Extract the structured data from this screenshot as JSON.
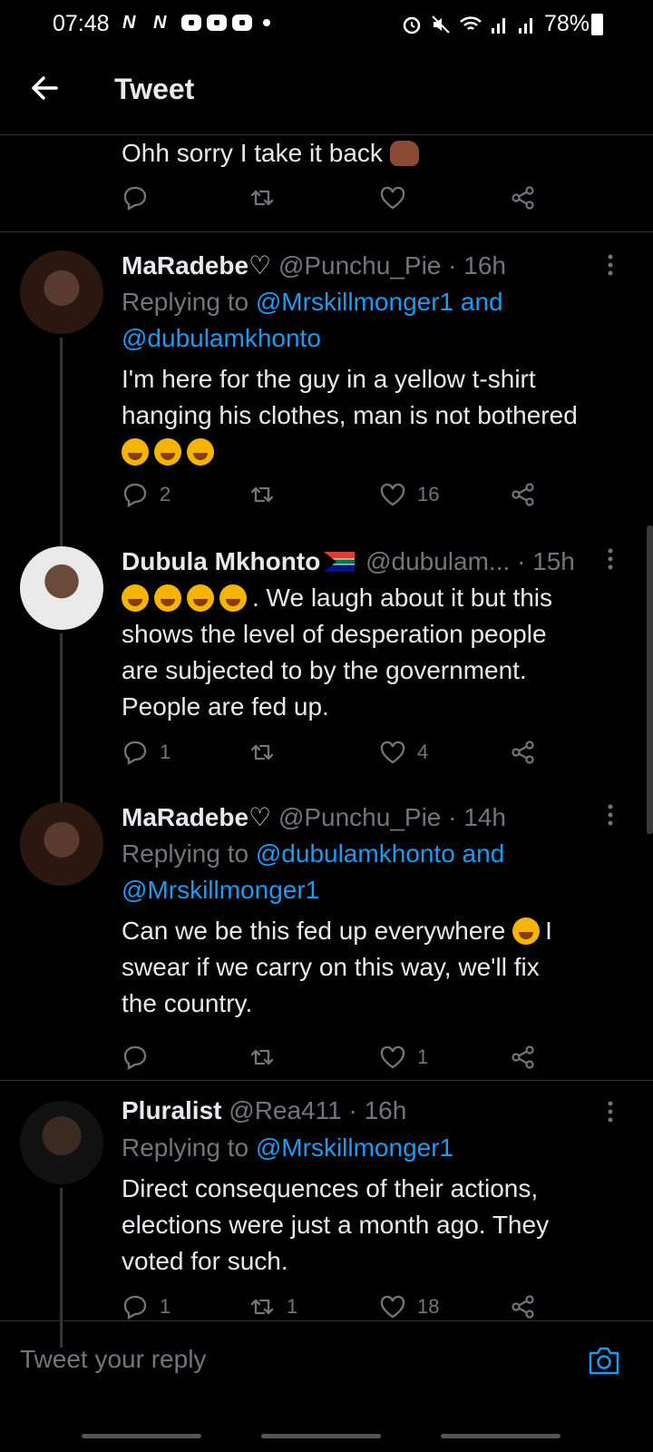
{
  "status_bar": {
    "time": "07:48",
    "notif_letters": [
      "N",
      "N"
    ],
    "battery": "78%"
  },
  "header": {
    "title": "Tweet"
  },
  "top_tweet": {
    "text": "Ohh sorry I take it back"
  },
  "tweets": [
    {
      "name": "MaRadebe♡",
      "handle": "@Punchu_Pie",
      "time": "· 16h",
      "reply_prefix": "Replying to",
      "reply_line1": "@Mrskillmonger1 and",
      "reply_line2": "@dubulamkhonto",
      "text1": "I'm here for the guy in a yellow t-shirt",
      "text2": "hanging his clothes, man is not bothered",
      "replies": "2",
      "retweets": "",
      "likes": "16"
    },
    {
      "name": "Dubula Mkhonto",
      "handle": "@dubulam...",
      "time": "· 15h",
      "text1": ".  We laugh about it but this",
      "text2": "shows the level of desperation people",
      "text3": "are subjected to by the government.",
      "text4": "People are fed up.",
      "replies": "1",
      "retweets": "",
      "likes": "4"
    },
    {
      "name": "MaRadebe♡",
      "handle": "@Punchu_Pie",
      "time": "· 14h",
      "reply_prefix": "Replying to",
      "reply_line1": "@dubulamkhonto and",
      "reply_line2": "@Mrskillmonger1",
      "text1": "Can we be this fed up everywhere",
      "text1b": "I",
      "text2": "swear if we carry on this way, we'll fix",
      "text3": "the country.",
      "replies": "",
      "retweets": "",
      "likes": "1"
    },
    {
      "name": "Pluralist",
      "handle": "@Rea411",
      "time": "· 16h",
      "reply_prefix": "Replying to",
      "reply_line1": "@Mrskillmonger1",
      "text1": "Direct consequences of their actions,",
      "text2": "elections were just a month ago. They",
      "text3": "voted for such.",
      "replies": "1",
      "retweets": "1",
      "likes": "18"
    }
  ],
  "reply_bar": {
    "placeholder": "Tweet your reply"
  },
  "icons": {
    "reply": "reply-icon",
    "retweet": "retweet-icon",
    "like": "heart-icon",
    "share": "share-icon",
    "more": "more-vertical-icon",
    "camera": "camera-icon",
    "back": "back-arrow-icon"
  },
  "colors": {
    "background": "#000000",
    "text": "#e7e9ea",
    "secondary": "#71767b",
    "link": "#1d9bf0",
    "divider": "#2f3336"
  }
}
